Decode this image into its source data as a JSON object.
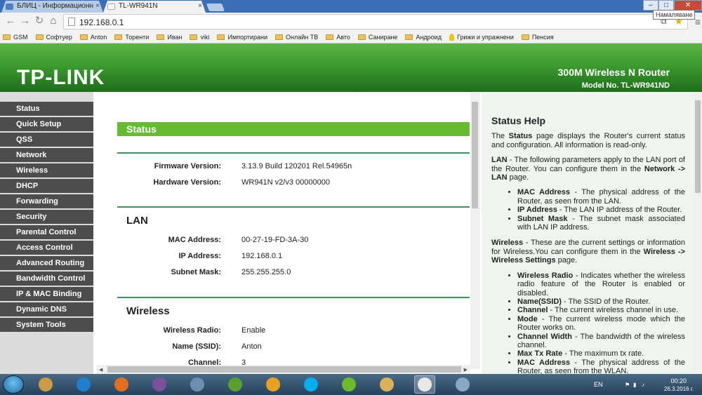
{
  "browser": {
    "tabs": [
      {
        "title": "БЛИЦ - Информационн",
        "active": false
      },
      {
        "title": "TL-WR941N",
        "active": true
      }
    ],
    "url": "192.168.0.1",
    "tooltip": "Намаляване",
    "window_controls": {
      "minimize": "–",
      "restore": "□",
      "close": "✕"
    },
    "bookmarks": [
      {
        "label": "GSM",
        "icon": "folder-icon"
      },
      {
        "label": "Софтуер",
        "icon": "folder-icon"
      },
      {
        "label": "Anton",
        "icon": "folder-icon"
      },
      {
        "label": "Торенти",
        "icon": "folder-icon"
      },
      {
        "label": "Иван",
        "icon": "folder-icon"
      },
      {
        "label": "viki",
        "icon": "folder-icon"
      },
      {
        "label": "Импортирани",
        "icon": "folder-icon"
      },
      {
        "label": "Онлайн ТВ",
        "icon": "folder-icon"
      },
      {
        "label": "Авто",
        "icon": "folder-icon"
      },
      {
        "label": "Саниране",
        "icon": "folder-icon"
      },
      {
        "label": "Андроид",
        "icon": "folder-icon"
      },
      {
        "label": "Грижи и упражнени",
        "icon": "bulb-icon"
      },
      {
        "label": "Пенсия",
        "icon": "folder-icon"
      }
    ]
  },
  "router": {
    "logo": "TP-LINK",
    "product": "300M Wireless N Router",
    "model": "Model No. TL-WR941ND",
    "menu": [
      "Status",
      "Quick Setup",
      "QSS",
      "Network",
      "Wireless",
      "DHCP",
      "Forwarding",
      "Security",
      "Parental Control",
      "Access Control",
      "Advanced Routing",
      "Bandwidth Control",
      "IP & MAC Binding",
      "Dynamic DNS",
      "System Tools"
    ],
    "status": {
      "title": "Status",
      "firmware_label": "Firmware Version:",
      "firmware_value": "3.13.9 Build 120201 Rel.54965n",
      "hardware_label": "Hardware Version:",
      "hardware_value": "WR941N v2/v3 00000000",
      "lan": {
        "title": "LAN",
        "mac_label": "MAC Address:",
        "mac_value": "00-27-19-FD-3A-30",
        "ip_label": "IP Address:",
        "ip_value": "192.168.0.1",
        "mask_label": "Subnet Mask:",
        "mask_value": "255.255.255.0"
      },
      "wireless": {
        "title": "Wireless",
        "radio_label": "Wireless Radio:",
        "radio_value": "Enable",
        "ssid_label": "Name (SSID):",
        "ssid_value": "Anton",
        "channel_label": "Channel:",
        "channel_value": "3"
      }
    },
    "help": {
      "title": "Status Help",
      "intro_pre": "The ",
      "intro_bold": "Status",
      "intro_post": " page displays the Router's current status and configuration. All information is read-only.",
      "lan_bold": "LAN",
      "lan_text": " - The following parameters apply to the LAN port of the Router. You can configure them in the ",
      "lan_link": "Network -> LAN",
      "lan_tail": " page.",
      "lan_items": [
        {
          "term": "MAC Address",
          "desc": " - The physical address of the Router, as seen from the LAN."
        },
        {
          "term": "IP Address",
          "desc": " - The LAN IP address of the Router."
        },
        {
          "term": "Subnet Mask",
          "desc": " - The subnet mask associated with LAN IP address."
        }
      ],
      "wl_bold": "Wireless",
      "wl_text": " - These are the current settings or information for Wireless.You can configure them in the ",
      "wl_link": "Wireless -> Wireless Settings",
      "wl_tail": " page.",
      "wl_items": [
        {
          "term": "Wireless Radio",
          "desc": " - Indicates whether the wireless radio feature of the Router is enabled or disabled."
        },
        {
          "term": "Name(SSID)",
          "desc": " - The SSID of the Router."
        },
        {
          "term": "Channel",
          "desc": " - The current wireless channel in use."
        },
        {
          "term": "Mode",
          "desc": " - The current wireless mode which the Router works on."
        },
        {
          "term": "Channel Width",
          "desc": " - The bandwidth of the wireless channel."
        },
        {
          "term": "Max Tx Rate",
          "desc": " - The maximum tx rate."
        },
        {
          "term": "MAC Address",
          "desc": " - The physical address of the Router, as seen from the WLAN."
        }
      ]
    }
  },
  "taskbar": {
    "language": "EN",
    "time": "00:20",
    "date": "26.3.2016 г.",
    "apps": [
      "tools-icon",
      "internet-explorer-icon",
      "firefox-icon",
      "viber-icon",
      "network-computer-icon",
      "utorrent-icon",
      "media-player-icon",
      "skype-icon",
      "bluestacks-icon",
      "file-explorer-icon",
      "chrome-icon",
      "paint-icon"
    ],
    "colors": {
      "accent": "#66bb33",
      "sidebar": "#4d4d4d",
      "banner": "#3d9a30"
    }
  }
}
